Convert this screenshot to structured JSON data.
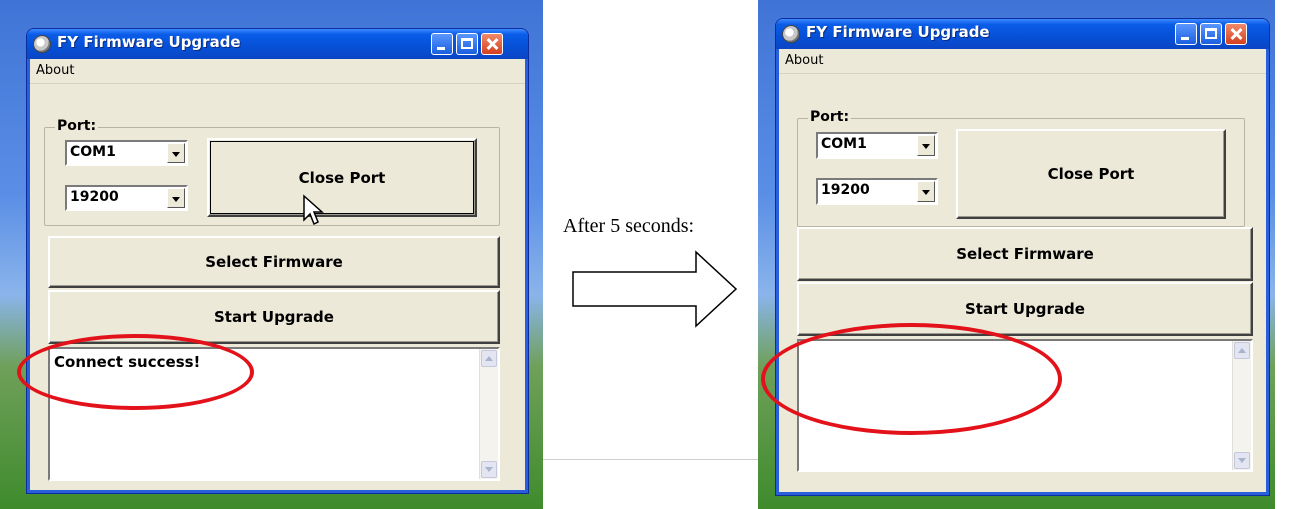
{
  "caption": "After 5 seconds:",
  "left_window": {
    "title": "FY Firmware Upgrade",
    "menu_about": "About",
    "port_label": "Port:",
    "com_value": "COM1",
    "baud_value": "19200",
    "close_port_label": "Close Port",
    "select_firmware_label": "Select Firmware",
    "start_upgrade_label": "Start Upgrade",
    "log_text": "Connect success!"
  },
  "right_window": {
    "title": "FY Firmware Upgrade",
    "menu_about": "About",
    "port_label": "Port:",
    "com_value": "COM1",
    "baud_value": "19200",
    "close_port_label": "Close Port",
    "select_firmware_label": "Select Firmware",
    "start_upgrade_label": "Start Upgrade",
    "log_text": ""
  },
  "colors": {
    "highlight_ellipse": "#e3121a",
    "titlebar_blue": "#0650d6",
    "window_face": "#ece9d8"
  },
  "icons": {
    "app_icon": "globe-icon",
    "minimize": "minimize-icon",
    "maximize": "maximize-icon",
    "close": "close-icon",
    "dropdown": "chevron-down-icon",
    "cursor": "mouse-pointer-icon",
    "arrow": "right-arrow-icon"
  }
}
